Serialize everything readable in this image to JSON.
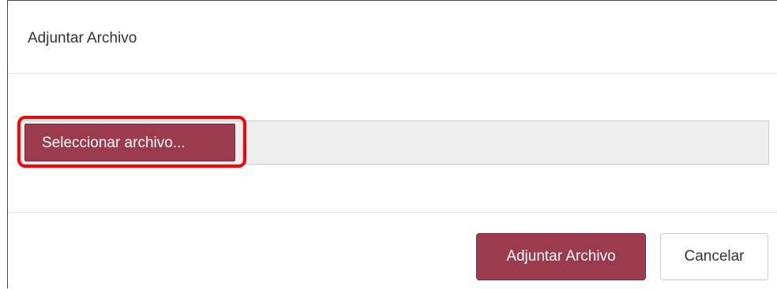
{
  "modal": {
    "title": "Adjuntar Archivo"
  },
  "file_input": {
    "select_label": "Seleccionar archivo...",
    "selected_file": ""
  },
  "footer": {
    "submit_label": "Adjuntar Archivo",
    "cancel_label": "Cancelar"
  },
  "colors": {
    "primary": "#9c3a4e",
    "highlight": "#ff0000"
  }
}
